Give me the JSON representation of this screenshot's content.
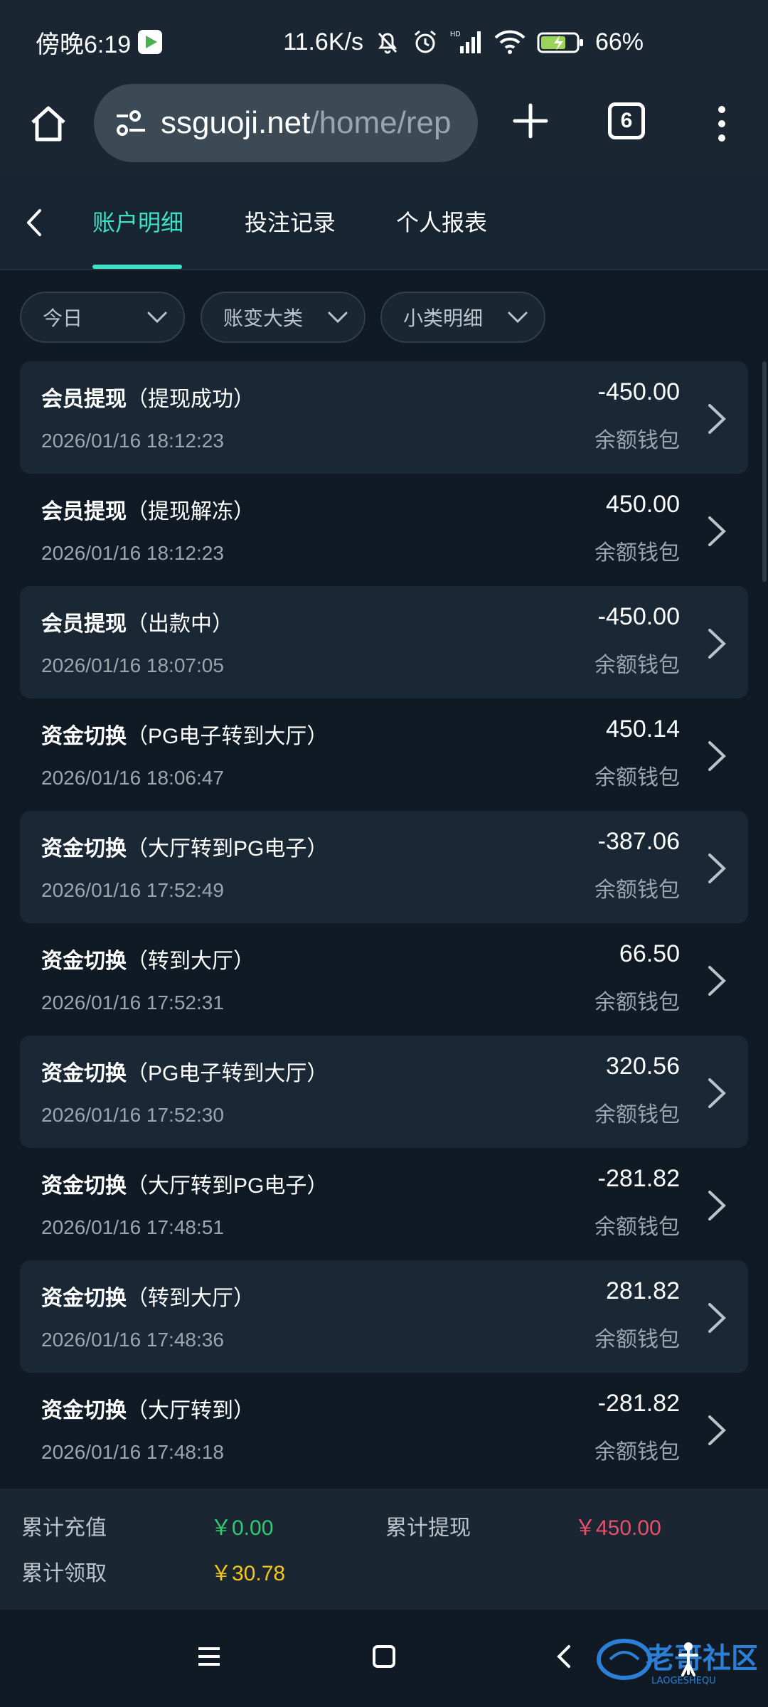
{
  "status_bar": {
    "time": "傍晚6:19",
    "net_speed": "11.6K/s",
    "battery": "66%"
  },
  "browser": {
    "url_host": "ssguoji.net",
    "url_path": "/home/rep",
    "tab_count": "6"
  },
  "nav": {
    "tabs": [
      {
        "label": "账户明细",
        "active": true
      },
      {
        "label": "投注记录",
        "active": false
      },
      {
        "label": "个人报表",
        "active": false
      }
    ]
  },
  "filters": [
    {
      "label": "今日"
    },
    {
      "label": "账变大类"
    },
    {
      "label": "小类明细"
    }
  ],
  "transactions": [
    {
      "category": "会员提现",
      "detail": "（提现成功）",
      "datetime": "2026/01/16 18:12:23",
      "amount": "-450.00",
      "wallet": "余额钱包"
    },
    {
      "category": "会员提现",
      "detail": "（提现解冻）",
      "datetime": "2026/01/16 18:12:23",
      "amount": "450.00",
      "wallet": "余额钱包"
    },
    {
      "category": "会员提现",
      "detail": "（出款中）",
      "datetime": "2026/01/16 18:07:05",
      "amount": "-450.00",
      "wallet": "余额钱包"
    },
    {
      "category": "资金切换",
      "detail": "（PG电子转到大厅）",
      "datetime": "2026/01/16 18:06:47",
      "amount": "450.14",
      "wallet": "余额钱包"
    },
    {
      "category": "资金切换",
      "detail": "（大厅转到PG电子）",
      "datetime": "2026/01/16 17:52:49",
      "amount": "-387.06",
      "wallet": "余额钱包"
    },
    {
      "category": "资金切换",
      "detail": "（转到大厅）",
      "datetime": "2026/01/16 17:52:31",
      "amount": "66.50",
      "wallet": "余额钱包"
    },
    {
      "category": "资金切换",
      "detail": "（PG电子转到大厅）",
      "datetime": "2026/01/16 17:52:30",
      "amount": "320.56",
      "wallet": "余额钱包"
    },
    {
      "category": "资金切换",
      "detail": "（大厅转到PG电子）",
      "datetime": "2026/01/16 17:48:51",
      "amount": "-281.82",
      "wallet": "余额钱包"
    },
    {
      "category": "资金切换",
      "detail": "（转到大厅）",
      "datetime": "2026/01/16 17:48:36",
      "amount": "281.82",
      "wallet": "余额钱包"
    },
    {
      "category": "资金切换",
      "detail": "（大厅转到）",
      "datetime": "2026/01/16 17:48:18",
      "amount": "-281.82",
      "wallet": "余额钱包"
    }
  ],
  "summary": {
    "recharge_label": "累计充值",
    "recharge_value": "￥0.00",
    "withdraw_label": "累计提现",
    "withdraw_value": "￥450.00",
    "claim_label": "累计领取",
    "claim_value": "￥30.78"
  },
  "watermark": {
    "text": "老哥社区",
    "sub": "LAOGESHEQU"
  },
  "colors": {
    "accent": "#3ee0c8",
    "positive": "#2ecc71",
    "negative": "#e8506a",
    "gold": "#f5c518"
  }
}
